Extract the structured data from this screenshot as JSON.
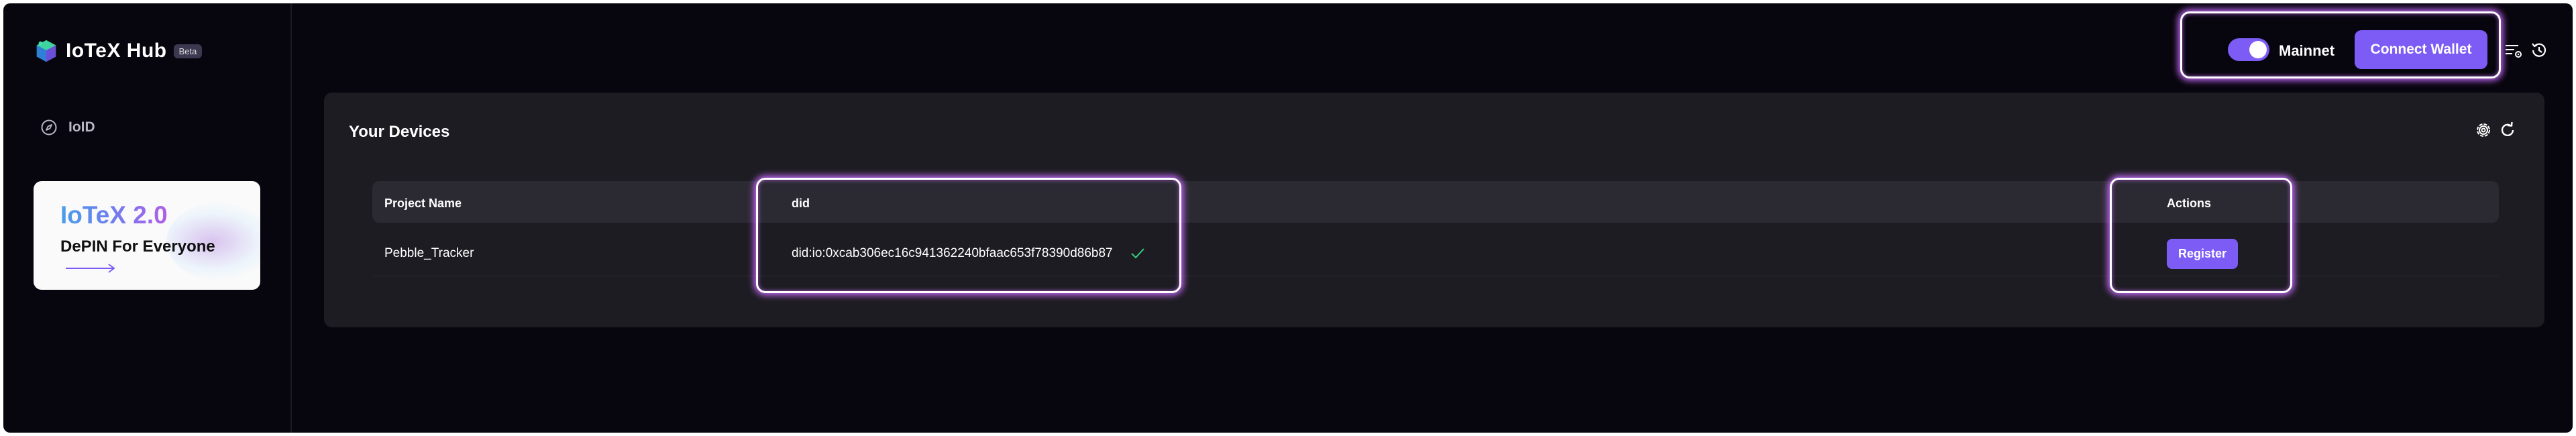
{
  "brand": {
    "name": "IoTeX Hub",
    "badge": "Beta"
  },
  "sidebar": {
    "nav_items": [
      {
        "label": "IoID",
        "icon": "compass-icon"
      }
    ],
    "promo": {
      "title": "IoTeX 2.0",
      "subtitle": "DePIN For Everyone"
    }
  },
  "header": {
    "network_label": "Mainnet",
    "network_toggle_on": true,
    "connect_label": "Connect Wallet",
    "icons": [
      "wallet-settings-icon",
      "history-icon"
    ]
  },
  "devices": {
    "title": "Your Devices",
    "icons": [
      "settings-icon",
      "refresh-icon"
    ],
    "columns": [
      "Project Name",
      "did",
      "Actions"
    ],
    "rows": [
      {
        "project": "Pebble_Tracker",
        "did": "did:io:0xcab306ec16c941362240bfaac653f78390d86b87",
        "verified": true,
        "action": "Register"
      }
    ]
  },
  "colors": {
    "background": "#07050d",
    "card": "#1d1c22",
    "accent": "#7d5cf6",
    "highlight_glow": "#c86aff",
    "success": "#35d07f"
  }
}
